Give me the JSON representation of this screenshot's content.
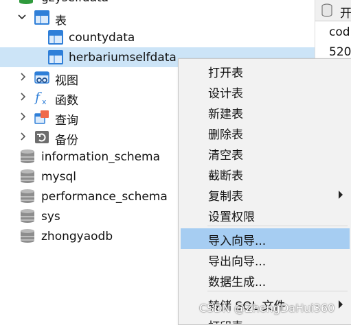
{
  "tree": {
    "db_partial": "gzyseifdata",
    "tables_label": "表",
    "tables": [
      "countydata",
      "herbariumselfdata"
    ],
    "groups": [
      "视图",
      "函数",
      "查询",
      "备份"
    ],
    "databases": [
      "information_schema",
      "mysql",
      "performance_schema",
      "sys",
      "zhongyaodb"
    ]
  },
  "right_panel": {
    "header": "开",
    "cells": [
      "cod",
      "520"
    ]
  },
  "context_menu": {
    "items": [
      "打开表",
      "设计表",
      "新建表",
      "删除表",
      "清空表",
      "截断表",
      "复制表",
      "设置权限",
      "导入向导...",
      "导出向导...",
      "数据生成...",
      "转储 SQL 文件",
      "打印表"
    ]
  },
  "watermark": "CSDN @ZhengDaHui360",
  "colors": {
    "selected_row": "#cce4f7",
    "menu_highlight": "#a6cdf2",
    "table_icon": "#2f7fd8"
  }
}
